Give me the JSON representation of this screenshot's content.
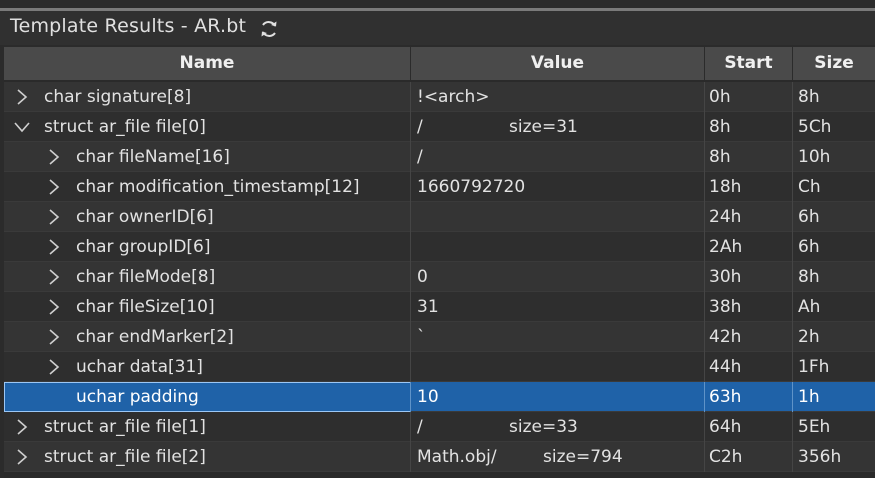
{
  "panel": {
    "title": "Template Results - AR.bt",
    "refresh_icon": "refresh-icon"
  },
  "columns": {
    "name": "Name",
    "value": "Value",
    "start": "Start",
    "size": "Size"
  },
  "rows": [
    {
      "name": "char signature[8]",
      "value": "!<arch>",
      "size_note": "",
      "start": "0h",
      "size": "8h",
      "expander": "collapsed",
      "indent": 0
    },
    {
      "name": "struct ar_file file[0]",
      "value": "/",
      "size_note": "size=31",
      "start": "8h",
      "size": "5Ch",
      "expander": "expanded",
      "indent": 0
    },
    {
      "name": "char fileName[16]",
      "value": "/",
      "size_note": "",
      "start": "8h",
      "size": "10h",
      "expander": "collapsed",
      "indent": 1
    },
    {
      "name": "char modification_timestamp[12]",
      "value": "1660792720",
      "size_note": "",
      "start": "18h",
      "size": "Ch",
      "expander": "collapsed",
      "indent": 1
    },
    {
      "name": "char ownerID[6]",
      "value": "",
      "size_note": "",
      "start": "24h",
      "size": "6h",
      "expander": "collapsed",
      "indent": 1
    },
    {
      "name": "char groupID[6]",
      "value": "",
      "size_note": "",
      "start": "2Ah",
      "size": "6h",
      "expander": "collapsed",
      "indent": 1
    },
    {
      "name": "char fileMode[8]",
      "value": "0",
      "size_note": "",
      "start": "30h",
      "size": "8h",
      "expander": "collapsed",
      "indent": 1
    },
    {
      "name": "char fileSize[10]",
      "value": "31",
      "size_note": "",
      "start": "38h",
      "size": "Ah",
      "expander": "collapsed",
      "indent": 1
    },
    {
      "name": "char endMarker[2]",
      "value": "`",
      "size_note": "",
      "start": "42h",
      "size": "2h",
      "expander": "collapsed",
      "indent": 1
    },
    {
      "name": "uchar data[31]",
      "value": "",
      "size_note": "",
      "start": "44h",
      "size": "1Fh",
      "expander": "collapsed",
      "indent": 1
    },
    {
      "name": "uchar padding",
      "value": "10",
      "size_note": "",
      "start": "63h",
      "size": "1h",
      "expander": "none",
      "indent": 1,
      "selected": true
    },
    {
      "name": "struct ar_file file[1]",
      "value": "/",
      "size_note": "size=33",
      "start": "64h",
      "size": "5Eh",
      "expander": "collapsed",
      "indent": 0
    },
    {
      "name": "struct ar_file file[2]",
      "value": "Math.obj/",
      "size_note": "size=794",
      "start": "C2h",
      "size": "356h",
      "expander": "collapsed",
      "indent": 0
    }
  ]
}
